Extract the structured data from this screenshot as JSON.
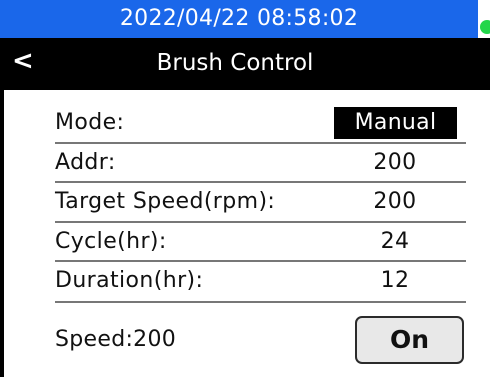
{
  "status_bar": {
    "datetime": "2022/04/22  08:58:02",
    "color": "#1a67ea",
    "indicator_color": "#23d64a"
  },
  "title_bar": {
    "back_label": "<",
    "title": "Brush Control"
  },
  "settings": [
    {
      "label": "Mode:",
      "value": "Manual"
    },
    {
      "label": "Addr:",
      "value": "200"
    },
    {
      "label": "Target Speed(rpm):",
      "value": "200"
    },
    {
      "label": "Cycle(hr):",
      "value": "24"
    },
    {
      "label": "Duration(hr):",
      "value": "12"
    }
  ],
  "footer": {
    "speed_label": "Speed:200",
    "toggle_label": "On"
  }
}
